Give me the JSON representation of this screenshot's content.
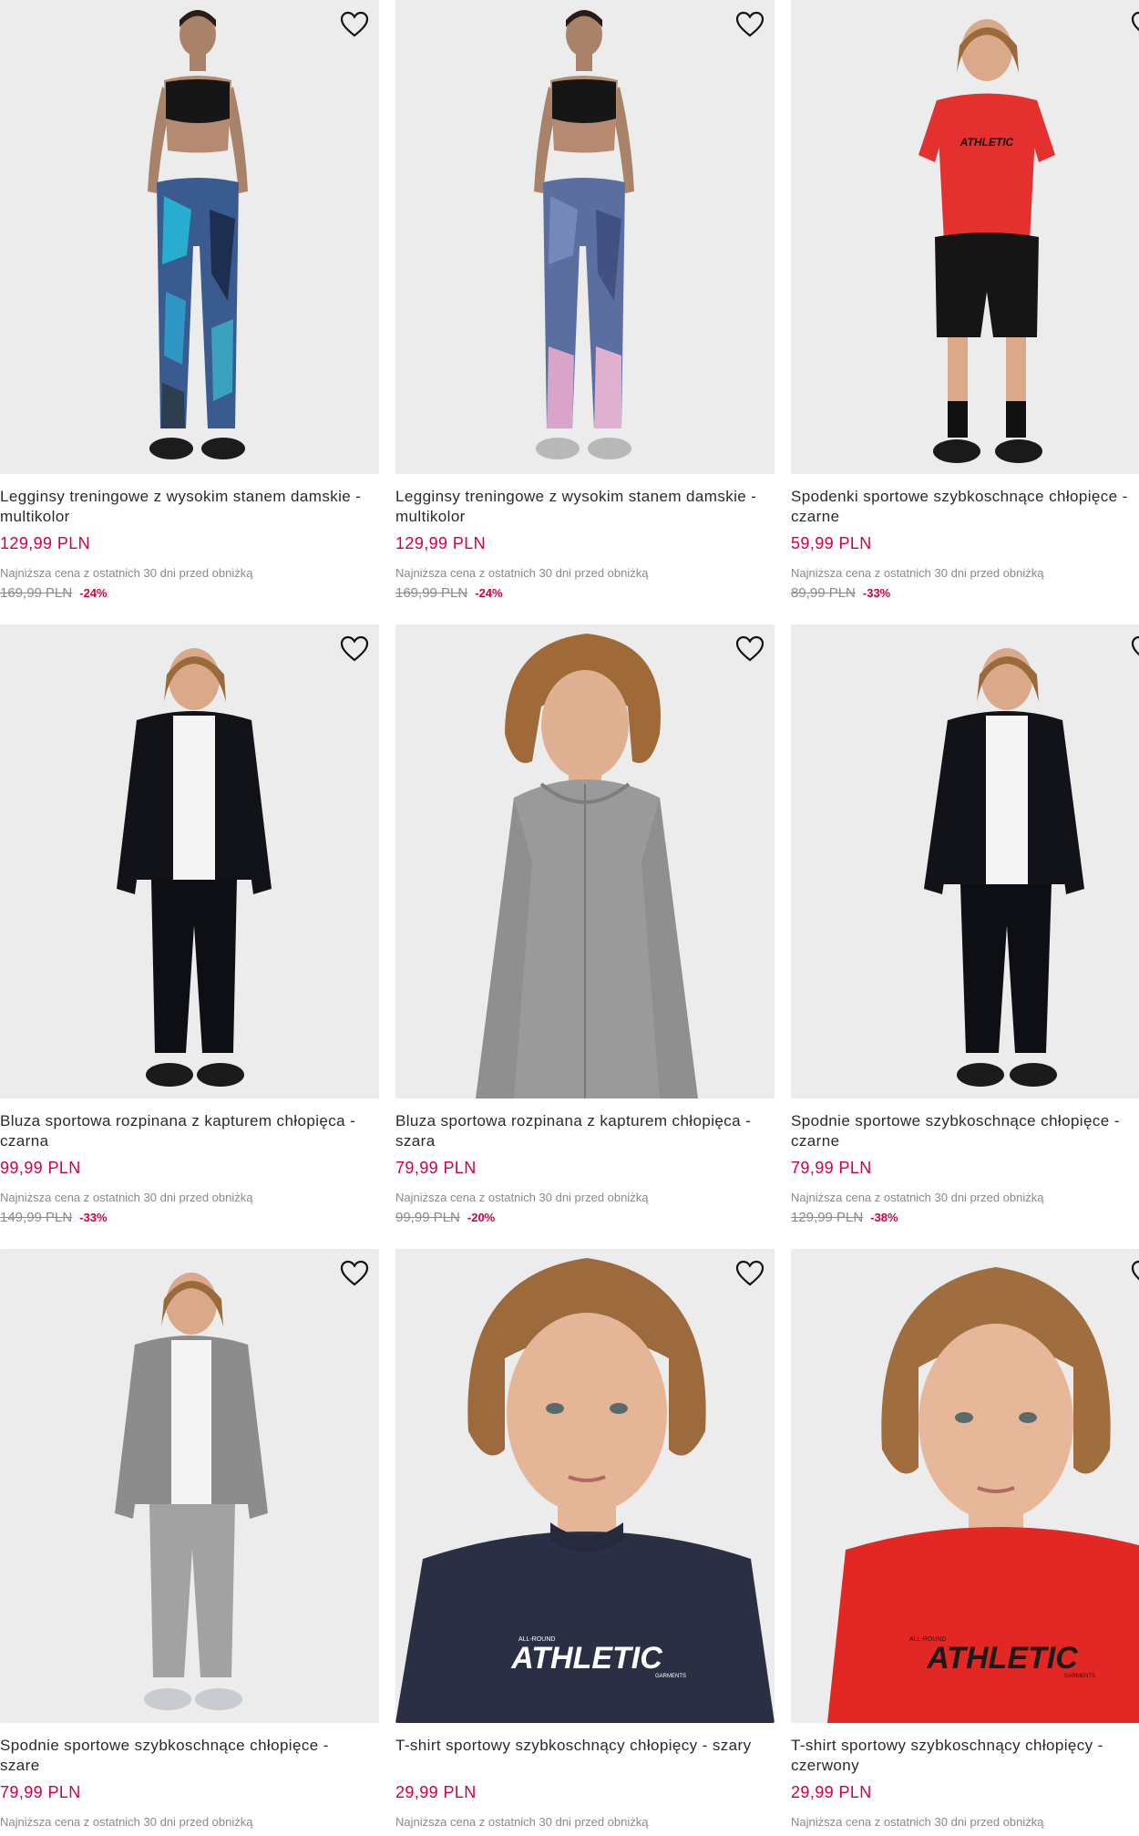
{
  "product_grid": {
    "products": [
      {
        "image_alt": "Woman in black sports bra and blue multicolor leggings",
        "name": "Legginsy treningowe z wysokim stanem damskie - multikolor",
        "price": "129,99 PLN",
        "lowest_price_label": "Najniższa cena z ostatnich 30 dni przed obniżką",
        "old_price": "169,99 PLN",
        "discount": "-24%"
      },
      {
        "image_alt": "Woman in black sports bra and pastel multicolor leggings",
        "name": "Legginsy treningowe z wysokim stanem damskie - multikolor",
        "price": "129,99 PLN",
        "lowest_price_label": "Najniższa cena z ostatnich 30 dni przed obniżką",
        "old_price": "169,99 PLN",
        "discount": "-24%"
      },
      {
        "image_alt": "Boy in red athletic t-shirt and black shorts",
        "name": "Spodenki sportowe szybkoschnące chłopięce - czarne",
        "price": "59,99 PLN",
        "lowest_price_label": "Najniższa cena z ostatnich 30 dni przed obniżką",
        "old_price": "89,99 PLN",
        "discount": "-33%"
      },
      {
        "image_alt": "Boy in black zip-up hoodie and black pants",
        "name": "Bluza sportowa rozpinana z kapturem chłopięca - czarna",
        "price": "99,99 PLN",
        "lowest_price_label": "Najniższa cena z ostatnich 30 dni przed obniżką",
        "old_price": "149,99 PLN",
        "discount": "-33%"
      },
      {
        "image_alt": "Boy in grey zip-up hoodie",
        "name": "Bluza sportowa rozpinana z kapturem chłopięca - szara",
        "price": "79,99 PLN",
        "lowest_price_label": "Najniższa cena z ostatnich 30 dni przed obniżką",
        "old_price": "99,99 PLN",
        "discount": "-20%"
      },
      {
        "image_alt": "Boy in black hoodie and black sport pants",
        "name": "Spodnie sportowe szybkoschnące chłopięce - czarne",
        "price": "79,99 PLN",
        "lowest_price_label": "Najniższa cena z ostatnich 30 dni przed obniżką",
        "old_price": "129,99 PLN",
        "discount": "-38%"
      },
      {
        "image_alt": "Boy in grey hoodie and grey sport pants",
        "name": "Spodnie sportowe szybkoschnące chłopięce - szare",
        "price": "79,99 PLN",
        "lowest_price_label": "Najniższa cena z ostatnich 30 dni przed obniżką",
        "old_price": "",
        "discount": ""
      },
      {
        "image_alt": "Boy in navy ATHLETIC t-shirt, close-up",
        "name": "T-shirt sportowy szybkoschnący chłopięcy - szary",
        "price": "29,99 PLN",
        "lowest_price_label": "Najniższa cena z ostatnich 30 dni przed obniżką",
        "old_price": "",
        "discount": ""
      },
      {
        "image_alt": "Boy in red ATHLETIC t-shirt, close-up",
        "name": "T-shirt sportowy szybkoschnący chłopięcy - czerwony",
        "price": "29,99 PLN",
        "lowest_price_label": "Najniższa cena z ostatnich 30 dni przed obniżką",
        "old_price": "",
        "discount": ""
      }
    ],
    "shirt_print_text": "ATHLETIC",
    "shirt_print_small": "ALL-ROUND",
    "shirt_print_brand": "GARMENTS"
  },
  "colors": {
    "price": "#d4003f",
    "text": "#2a2a2a",
    "muted": "#8a8a8a",
    "photo_bg": "#ececec"
  },
  "icons": {
    "favorite": "heart-outline-icon"
  }
}
